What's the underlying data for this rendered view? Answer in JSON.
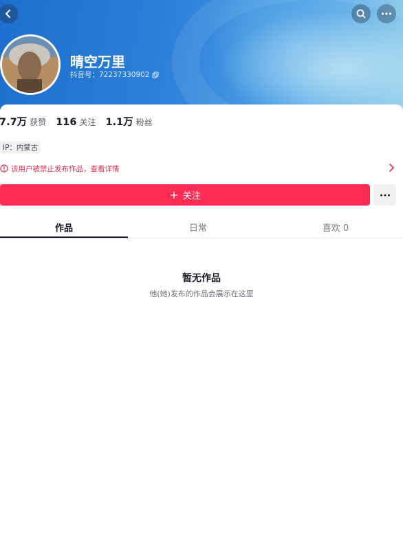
{
  "profile": {
    "name": "晴空万里",
    "douyin_id": "抖音号：72237330902"
  },
  "stats": [
    {
      "value": "7.7万",
      "label": "获赞"
    },
    {
      "value": "116",
      "label": "关注"
    },
    {
      "value": "1.1万",
      "label": "粉丝"
    }
  ],
  "ip_tag": "IP：内蒙古",
  "warning": {
    "text": "该用户被禁止发布作品，查看详情",
    "color": "#e0304e"
  },
  "follow_button": {
    "plus": "+",
    "label": "关注",
    "color": "#fe2c55"
  },
  "tabs": [
    {
      "label": "作品"
    },
    {
      "label": "日常"
    },
    {
      "label": "喜欢 0"
    }
  ],
  "empty_state": {
    "title": "暂无作品",
    "description": "他(她)发布的作品会展示在这里"
  },
  "icons": {
    "back": "chevron-left-icon",
    "search": "search-icon",
    "more": "more-dots-icon",
    "copy": "copy-icon",
    "warning": "alert-circle-icon",
    "chevron": "chevron-right-icon"
  }
}
